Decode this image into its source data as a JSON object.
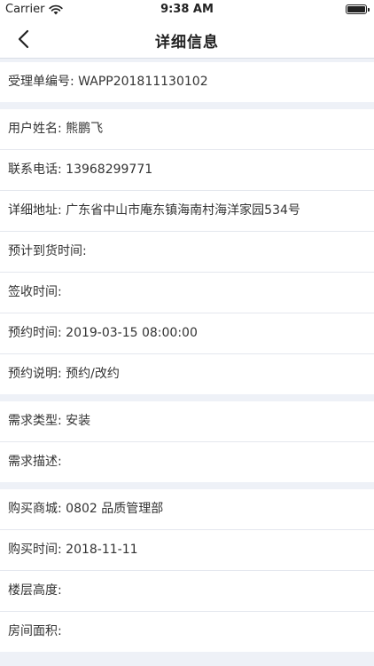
{
  "status_bar": {
    "carrier": "Carrier",
    "time": "9:38 AM"
  },
  "nav": {
    "title": "详细信息",
    "back_icon": "chevron-left-icon"
  },
  "sections": [
    {
      "rows": [
        {
          "label": "受理单编号:",
          "value": "WAPP201811130102"
        }
      ]
    },
    {
      "rows": [
        {
          "label": "用户姓名:",
          "value": "熊鹏飞"
        },
        {
          "label": "联系电话:",
          "value": "13968299771"
        },
        {
          "label": "详细地址:",
          "value": "广东省中山市庵东镇海南村海洋家园534号"
        },
        {
          "label": "预计到货时间:",
          "value": ""
        },
        {
          "label": "签收时间:",
          "value": ""
        },
        {
          "label": "预约时间:",
          "value": "2019-03-15 08:00:00"
        },
        {
          "label": "预约说明:",
          "value": "预约/改约"
        }
      ]
    },
    {
      "rows": [
        {
          "label": "需求类型:",
          "value": "安装"
        },
        {
          "label": "需求描述:",
          "value": ""
        }
      ]
    },
    {
      "rows": [
        {
          "label": "购买商城:",
          "value": "0802 品质管理部"
        },
        {
          "label": "购买时间:",
          "value": "2018-11-11"
        },
        {
          "label": "楼层高度:",
          "value": ""
        },
        {
          "label": "房间面积:",
          "value": ""
        }
      ]
    }
  ]
}
